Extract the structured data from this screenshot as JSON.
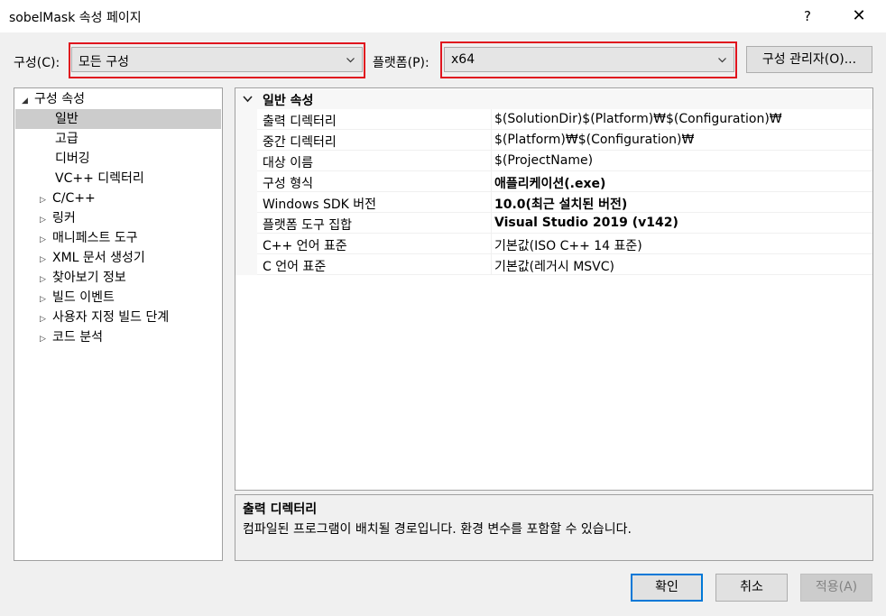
{
  "window": {
    "title": "sobelMask 속성 페이지",
    "help_label": "?",
    "close_label": "✕"
  },
  "toolbar": {
    "config_label": "구성(C):",
    "config_value": "모든 구성",
    "platform_label": "플랫폼(P):",
    "platform_value": "x64",
    "manager_label": "구성 관리자(O)..."
  },
  "tree": {
    "root": "구성 속성",
    "items": [
      {
        "label": "일반",
        "expandable": false,
        "selected": true
      },
      {
        "label": "고급",
        "expandable": false
      },
      {
        "label": "디버깅",
        "expandable": false
      },
      {
        "label": "VC++ 디렉터리",
        "expandable": false
      },
      {
        "label": "C/C++",
        "expandable": true
      },
      {
        "label": "링커",
        "expandable": true
      },
      {
        "label": "매니페스트 도구",
        "expandable": true
      },
      {
        "label": "XML 문서 생성기",
        "expandable": true
      },
      {
        "label": "찾아보기 정보",
        "expandable": true
      },
      {
        "label": "빌드 이벤트",
        "expandable": true
      },
      {
        "label": "사용자 지정 빌드 단계",
        "expandable": true
      },
      {
        "label": "코드 분석",
        "expandable": true
      }
    ]
  },
  "properties": {
    "category": "일반 속성",
    "rows": [
      {
        "name": "출력 디렉터리",
        "value": "$(SolutionDir)$(Platform)₩$(Configuration)₩",
        "bold": false
      },
      {
        "name": "중간 디렉터리",
        "value": "$(Platform)₩$(Configuration)₩",
        "bold": false
      },
      {
        "name": "대상 이름",
        "value": "$(ProjectName)",
        "bold": false
      },
      {
        "name": "구성 형식",
        "value": "애플리케이션(.exe)",
        "bold": true
      },
      {
        "name": "Windows SDK 버전",
        "value": "10.0(최근 설치된 버전)",
        "bold": true
      },
      {
        "name": "플랫폼 도구 집합",
        "value": "Visual Studio 2019 (v142)",
        "bold": true
      },
      {
        "name": "C++ 언어 표준",
        "value": "기본값(ISO C++ 14 표준)",
        "bold": false
      },
      {
        "name": "C 언어 표준",
        "value": "기본값(레거시 MSVC)",
        "bold": false
      }
    ]
  },
  "description": {
    "title": "출력 디렉터리",
    "text": "컴파일된 프로그램이 배치될 경로입니다. 환경 변수를 포함할 수 있습니다."
  },
  "buttons": {
    "ok": "확인",
    "cancel": "취소",
    "apply": "적용(A)"
  },
  "colors": {
    "highlight": "#e0141e",
    "primary_border": "#0078d7",
    "selection": "#cccccc"
  }
}
